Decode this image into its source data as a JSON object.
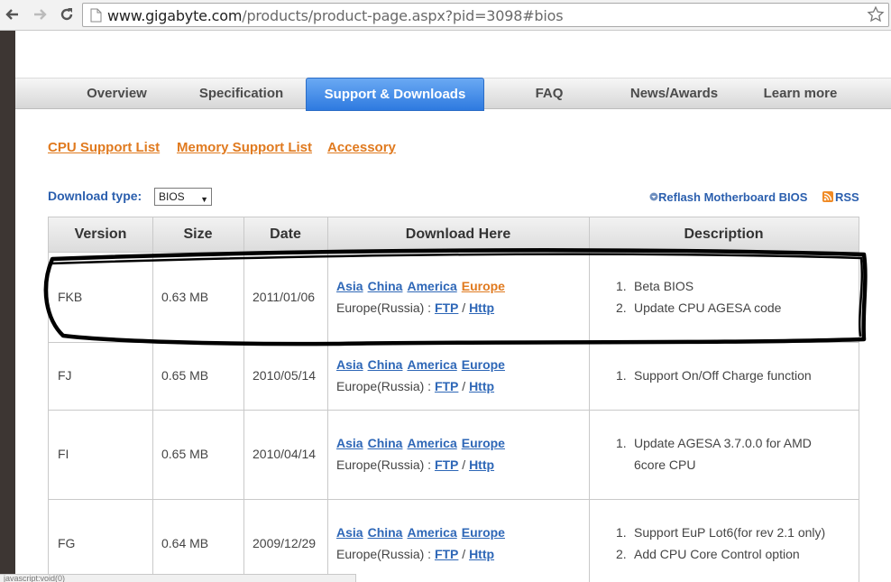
{
  "browser": {
    "url_host": "www.gigabyte.com",
    "url_path": "/products/product-page.aspx?pid=3098#bios",
    "status_text": "javascript:void(0)"
  },
  "tabs": [
    {
      "label": "Overview"
    },
    {
      "label": "Specification"
    },
    {
      "label": "Support & Downloads"
    },
    {
      "label": "FAQ"
    },
    {
      "label": "News/Awards"
    },
    {
      "label": "Learn more"
    }
  ],
  "sublinks": {
    "cpu": "CPU Support List",
    "memory": "Memory Support List",
    "accessory": "Accessory"
  },
  "download": {
    "label": "Download type:",
    "selected": "BIOS",
    "reflash": "Reflash Motherboard BIOS",
    "rss": "RSS"
  },
  "table": {
    "headers": [
      "Version",
      "Size",
      "Date",
      "Download Here",
      "Description"
    ],
    "mirror_labels": {
      "asia": "Asia",
      "china": "China",
      "america": "America",
      "europe": "Europe",
      "russia_prefix": "Europe(Russia) :",
      "ftp": "FTP",
      "sep": "/",
      "http": "Http"
    },
    "rows": [
      {
        "version": "FKB",
        "size": "0.63 MB",
        "date": "2011/01/06",
        "desc": [
          "Beta BIOS",
          "Update CPU AGESA code"
        ]
      },
      {
        "version": "FJ",
        "size": "0.65 MB",
        "date": "2010/05/14",
        "desc": [
          "Support On/Off Charge function"
        ]
      },
      {
        "version": "FI",
        "size": "0.65 MB",
        "date": "2010/04/14",
        "desc": [
          "Update AGESA 3.7.0.0 for AMD",
          "6core CPU"
        ]
      },
      {
        "version": "FG",
        "size": "0.64 MB",
        "date": "2009/12/29",
        "desc": [
          "Support EuP Lot6(for rev 2.1 only)",
          "Add CPU Core Control option"
        ]
      }
    ]
  },
  "colors": {
    "link_blue": "#2e67b7",
    "link_orange": "#e07a1f",
    "tab_active": "#3b86e8"
  }
}
